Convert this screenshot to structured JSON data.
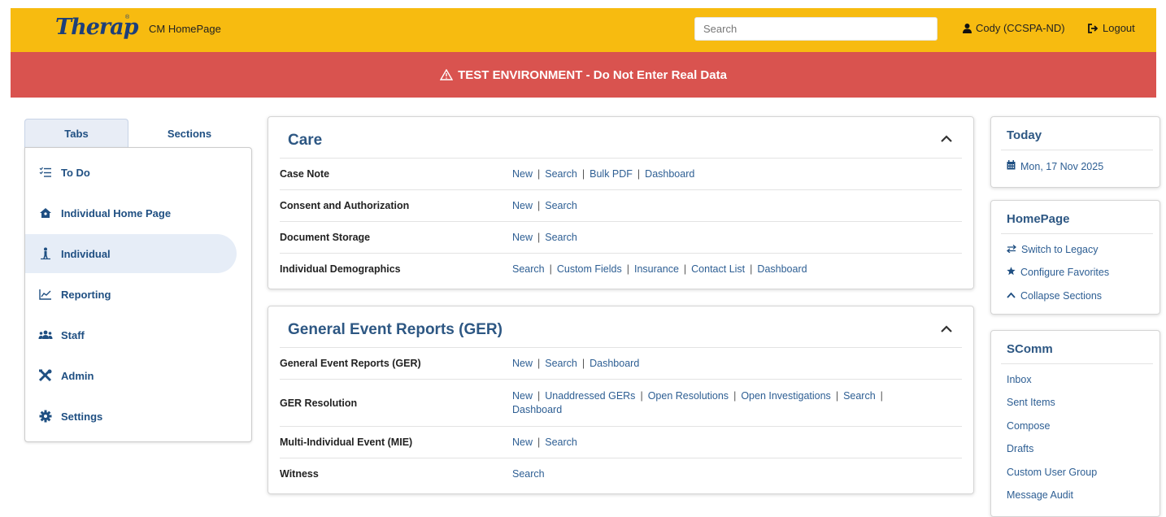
{
  "header": {
    "logo_text": "Therap",
    "logo_reg": "®",
    "app_title": "CM HomePage",
    "search_placeholder": "Search",
    "user_name": "Cody (CCSPA-ND)",
    "logout_label": "Logout",
    "bar_color": "#f7bb10"
  },
  "banner": {
    "text": "TEST ENVIRONMENT - Do Not Enter Real Data",
    "color": "#d9534f"
  },
  "leftnav": {
    "tabs": [
      {
        "label": "Tabs",
        "active": true
      },
      {
        "label": "Sections",
        "active": false
      }
    ],
    "items": [
      {
        "label": "To Do",
        "icon": "checklist-icon"
      },
      {
        "label": "Individual Home Page",
        "icon": "house-icon"
      },
      {
        "label": "Individual",
        "icon": "person-icon",
        "active": true
      },
      {
        "label": "Reporting",
        "icon": "chart-line-icon"
      },
      {
        "label": "Staff",
        "icon": "users-icon"
      },
      {
        "label": "Admin",
        "icon": "tools-icon"
      },
      {
        "label": "Settings",
        "icon": "gear-icon"
      }
    ]
  },
  "main": {
    "panels": [
      {
        "title": "Care",
        "rows": [
          {
            "label": "Case Note",
            "links": [
              "New",
              "Search",
              "Bulk PDF",
              "Dashboard"
            ]
          },
          {
            "label": "Consent and Authorization",
            "links": [
              "New",
              "Search"
            ]
          },
          {
            "label": "Document Storage",
            "links": [
              "New",
              "Search"
            ]
          },
          {
            "label": "Individual Demographics",
            "links": [
              "Search",
              "Custom Fields",
              "Insurance",
              "Contact List",
              "Dashboard"
            ]
          }
        ]
      },
      {
        "title": "General Event Reports (GER)",
        "rows": [
          {
            "label": "General Event Reports (GER)",
            "links": [
              "New",
              "Search",
              "Dashboard"
            ]
          },
          {
            "label": "GER Resolution",
            "links": [
              "New",
              "Unaddressed GERs",
              "Open Resolutions",
              "Open Investigations",
              "Search",
              "Dashboard"
            ]
          },
          {
            "label": "Multi-Individual Event (MIE)",
            "links": [
              "New",
              "Search"
            ]
          },
          {
            "label": "Witness",
            "links": [
              "Search"
            ]
          }
        ]
      }
    ]
  },
  "sidebar": {
    "today": {
      "title": "Today",
      "date": "Mon, 17 Nov 2025"
    },
    "homepage": {
      "title": "HomePage",
      "items": [
        {
          "label": "Switch to Legacy",
          "icon": "swap-icon"
        },
        {
          "label": "Configure Favorites",
          "icon": "star-icon"
        },
        {
          "label": "Collapse Sections",
          "icon": "chevron-up-icon"
        }
      ]
    },
    "scomm": {
      "title": "SComm",
      "items": [
        "Inbox",
        "Sent Items",
        "Compose",
        "Drafts",
        "Custom User Group",
        "Message Audit"
      ]
    }
  }
}
